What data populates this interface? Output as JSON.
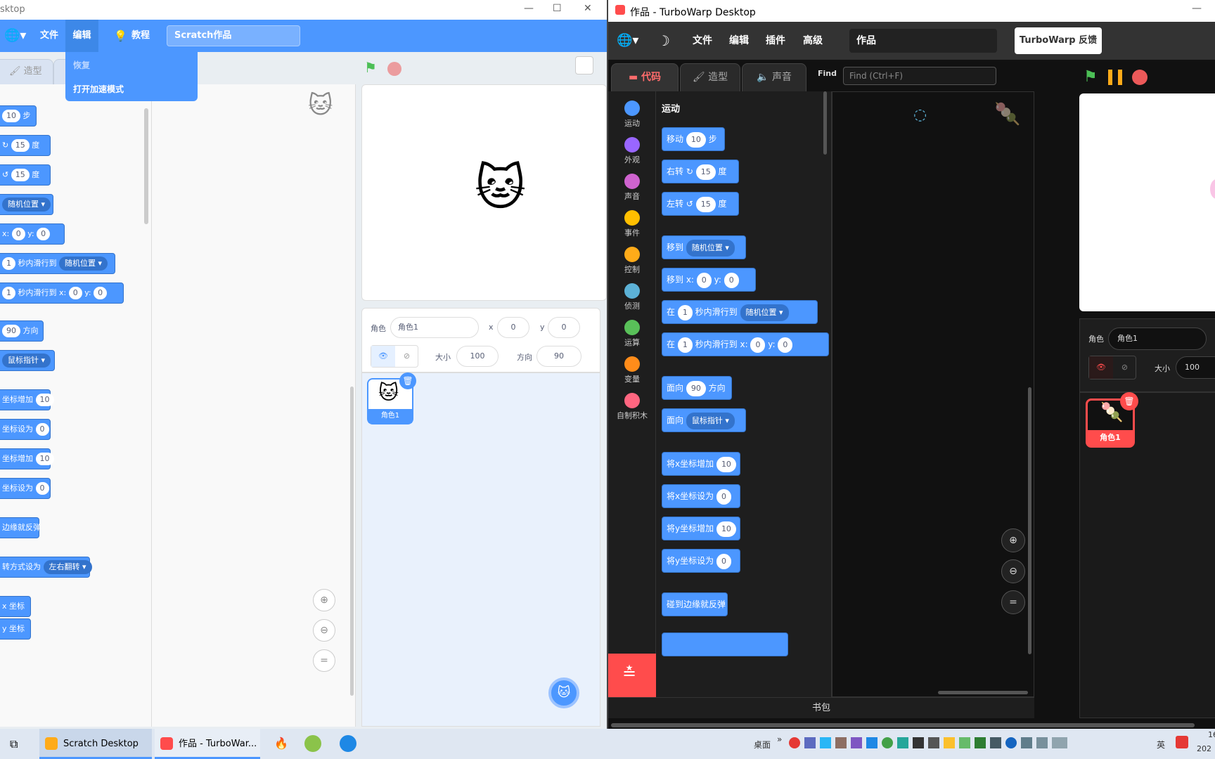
{
  "left_window": {
    "title": "sktop",
    "window_buttons": [
      "—",
      "☐",
      "✕"
    ],
    "menu": {
      "file": "文件",
      "edit": "编辑",
      "tutorials": "教程",
      "project_title": "Scratch作品"
    },
    "edit_menu": {
      "restore": "恢复",
      "turbo_mode": "打开加速模式"
    },
    "tabs": {
      "costumes": "造型"
    },
    "palette_blocks": [
      {
        "pre": "",
        "in1": "10",
        "mid": "步",
        "in2": "",
        "post": ""
      },
      {
        "pre": "↻",
        "in1": "15",
        "mid": "度",
        "in2": "",
        "post": ""
      },
      {
        "pre": "↺",
        "in1": "15",
        "mid": "度",
        "in2": "",
        "post": ""
      },
      {
        "pre": "",
        "dd": "随机位置 ▾"
      },
      {
        "pre": "x:",
        "in1": "0",
        "mid": "y:",
        "in2": "0",
        "post": ""
      },
      {
        "pre": "",
        "in1": "1",
        "mid": "秒内滑行到",
        "dd": "随机位置 ▾"
      },
      {
        "pre": "",
        "in1": "1",
        "mid": "秒内滑行到 x:",
        "in2": "0",
        "post": "y:",
        "in3": "0"
      },
      {
        "pre": "",
        "in1": "90",
        "mid": "方向"
      },
      {
        "pre": "",
        "dd": "鼠标指针 ▾"
      },
      {
        "pre": "坐标增加",
        "in1": "10"
      },
      {
        "pre": "坐标设为",
        "in1": "0"
      },
      {
        "pre": "坐标增加",
        "in1": "10"
      },
      {
        "pre": "坐标设为",
        "in1": "0"
      },
      {
        "pre": "边缘就反弹"
      },
      {
        "pre": "转方式设为",
        "dd": "左右翻转 ▾"
      },
      {
        "pre": "x 坐标"
      },
      {
        "pre": "y 坐标"
      }
    ],
    "sprite_info": {
      "sprite_label": "角色",
      "sprite_name": "角色1",
      "x_label": "x",
      "x": "0",
      "y_label": "y",
      "y": "0",
      "size_label": "大小",
      "size": "100",
      "direction_label": "方向",
      "direction": "90"
    },
    "sprite_tile": {
      "name": "角色1"
    }
  },
  "right_window": {
    "title": "作品 - TurboWarp Desktop",
    "menu": {
      "file": "文件",
      "edit": "编辑",
      "addons": "插件",
      "advanced": "高级",
      "project_title": "作品",
      "feedback": "TurboWarp 反馈"
    },
    "tabs": {
      "code": "代码",
      "costumes": "造型",
      "sounds": "声音"
    },
    "find": {
      "label": "Find",
      "placeholder": "Find (Ctrl+F)"
    },
    "categories": [
      {
        "label": "运动",
        "color": "#4c97ff"
      },
      {
        "label": "外观",
        "color": "#9966ff"
      },
      {
        "label": "声音",
        "color": "#cf63cf"
      },
      {
        "label": "事件",
        "color": "#ffbf00"
      },
      {
        "label": "控制",
        "color": "#ffab19"
      },
      {
        "label": "侦测",
        "color": "#5cb1d6"
      },
      {
        "label": "运算",
        "color": "#59c059"
      },
      {
        "label": "变量",
        "color": "#ff8c1a"
      },
      {
        "label": "自制积木",
        "color": "#ff6680"
      }
    ],
    "palette_heading": "运动",
    "blocks": [
      {
        "a": "移动",
        "i1": "10",
        "b": "步"
      },
      {
        "a": "右转 ↻",
        "i1": "15",
        "b": "度"
      },
      {
        "a": "左转 ↺",
        "i1": "15",
        "b": "度"
      },
      {
        "a": "移到",
        "dd": "随机位置 ▾"
      },
      {
        "a": "移到 x:",
        "i1": "0",
        "b": "y:",
        "i2": "0"
      },
      {
        "a": "在",
        "i1": "1",
        "b": "秒内滑行到",
        "dd": "随机位置 ▾"
      },
      {
        "a": "在",
        "i1": "1",
        "b": "秒内滑行到 x:",
        "i2": "0",
        "c": "y:",
        "i3": "0"
      },
      {
        "a": "面向",
        "i1": "90",
        "b": "方向"
      },
      {
        "a": "面向",
        "dd": "鼠标指针 ▾"
      },
      {
        "a": "将x坐标增加",
        "i1": "10"
      },
      {
        "a": "将x坐标设为",
        "i1": "0"
      },
      {
        "a": "将y坐标增加",
        "i1": "10"
      },
      {
        "a": "将y坐标设为",
        "i1": "0"
      },
      {
        "a": "碰到边缘就反弹"
      }
    ],
    "backpack": "书包",
    "sprite_info": {
      "sprite_label": "角色",
      "sprite_name": "角色1",
      "size_label": "大小",
      "size": "100"
    },
    "sprite_tile": {
      "name": "角色1"
    }
  },
  "taskbar": {
    "apps": [
      {
        "label": "Scratch Desktop"
      },
      {
        "label": "作品 - TurboWar..."
      }
    ],
    "desktop": "桌面",
    "ime": "英",
    "clock_partial": "16",
    "date_partial": "202"
  }
}
